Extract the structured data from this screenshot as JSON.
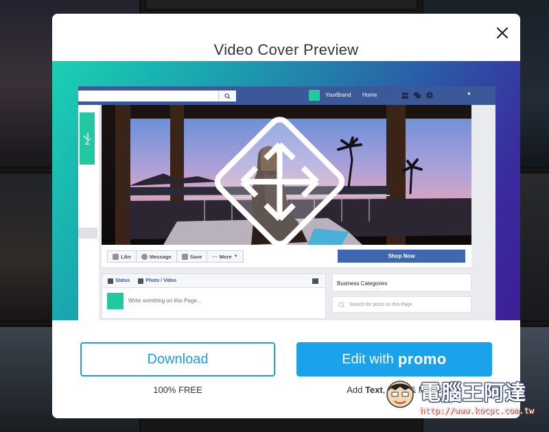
{
  "modal": {
    "title": "Video Cover Preview",
    "close_icon": "close-icon"
  },
  "facebook_mock": {
    "brand": "YourBrand",
    "home": "Home",
    "buttons": [
      "Like",
      "Message",
      "Save",
      "More"
    ],
    "shop_now": "Shop Now",
    "composer_tabs": [
      "Status",
      "Photo / Video"
    ],
    "composer_placeholder": "Write somthing on this Page...",
    "business_categories": "Business Categories",
    "search_posts_placeholder": "Search for posts on this Page"
  },
  "actions": {
    "download_label": "Download",
    "download_sub": "100% FREE",
    "edit_label": "Edit with",
    "edit_brand": "promo",
    "edit_sub_prefix": "Add ",
    "edit_sub_text": "Text",
    "edit_sub_mid": ", Logo & Music"
  },
  "watermark": {
    "text": "電腦王阿達",
    "url": "http://www.kocpc.com.tw"
  },
  "colors": {
    "accent": "#1aa3ea",
    "facebook_blue": "#3b5998",
    "brand_green": "#21c8a0"
  }
}
